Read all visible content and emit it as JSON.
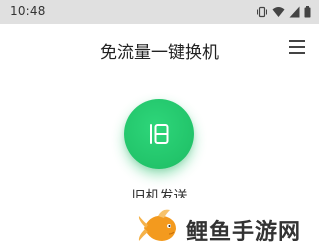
{
  "status_bar": {
    "time": "10:48",
    "icons": [
      "vibrate-icon",
      "wifi-icon",
      "signal-icon",
      "battery-icon"
    ]
  },
  "header": {
    "title": "免流量一键换机",
    "menu_icon": "menu-icon"
  },
  "main": {
    "action_icon": "phone-transfer-icon",
    "action_label": "旧机发送"
  },
  "watermark": {
    "text": "鲤鱼手游网"
  },
  "colors": {
    "accent": "#22c46a",
    "status_bar_bg": "#e0e0e0",
    "watermark_orange": "#f39a1e"
  }
}
